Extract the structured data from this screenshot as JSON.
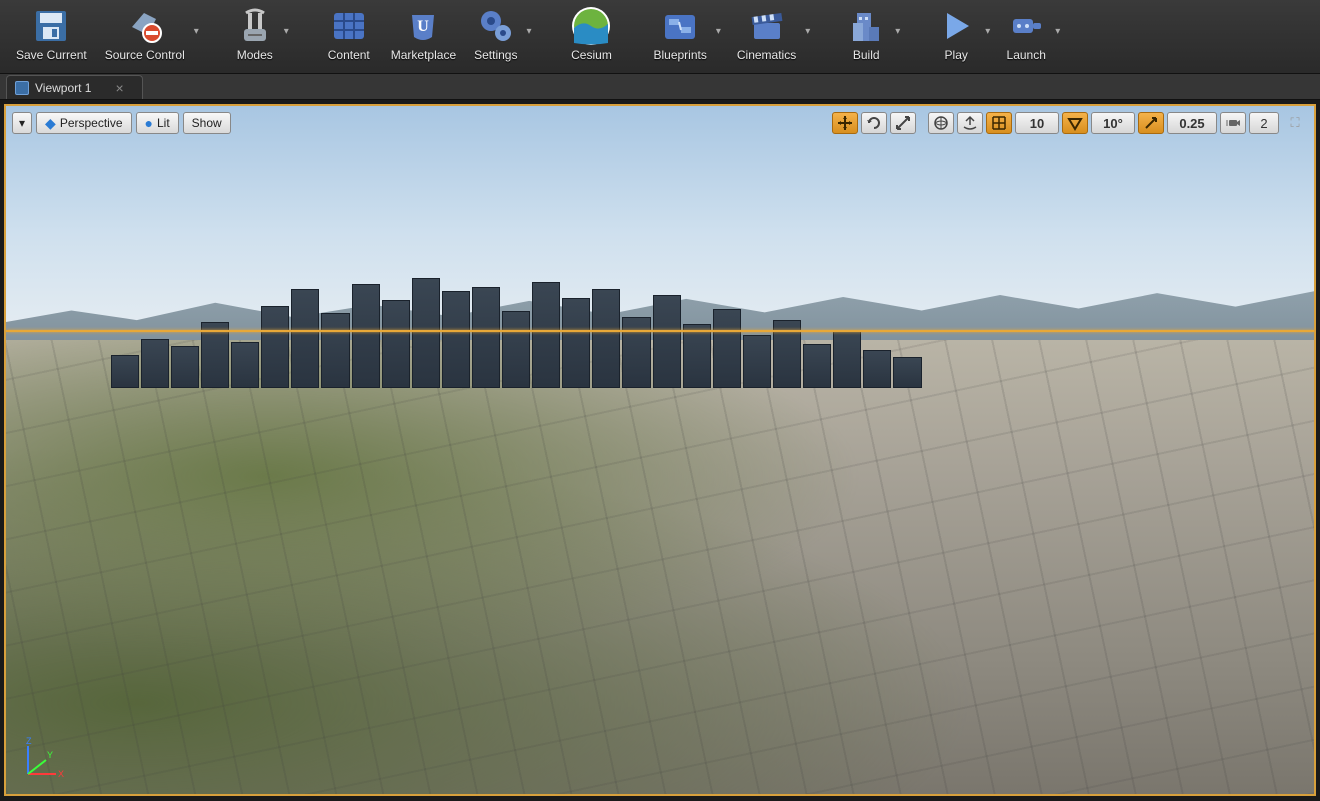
{
  "toolbar": {
    "items": [
      {
        "label": "Save Current",
        "icon": "save-icon",
        "dropdown": false
      },
      {
        "label": "Source Control",
        "icon": "source-control-icon",
        "dropdown": true
      },
      {
        "label": "Modes",
        "icon": "modes-icon",
        "dropdown": true
      },
      {
        "label": "Content",
        "icon": "content-icon",
        "dropdown": false
      },
      {
        "label": "Marketplace",
        "icon": "marketplace-icon",
        "dropdown": false
      },
      {
        "label": "Settings",
        "icon": "settings-icon",
        "dropdown": true
      },
      {
        "label": "Cesium",
        "icon": "cesium-icon",
        "dropdown": false
      },
      {
        "label": "Blueprints",
        "icon": "blueprints-icon",
        "dropdown": true
      },
      {
        "label": "Cinematics",
        "icon": "cinematics-icon",
        "dropdown": true
      },
      {
        "label": "Build",
        "icon": "build-icon",
        "dropdown": true
      },
      {
        "label": "Play",
        "icon": "play-icon",
        "dropdown": true
      },
      {
        "label": "Launch",
        "icon": "launch-icon",
        "dropdown": true
      }
    ]
  },
  "tabs": {
    "active": "Viewport 1"
  },
  "viewport": {
    "left": {
      "options_dropdown": "▾",
      "perspective": "Perspective",
      "lit": "Lit",
      "show": "Show"
    },
    "right": {
      "grid_snap": "10",
      "rotation_snap": "10°",
      "scale_snap": "0.25",
      "camera_speed": "2"
    }
  },
  "colors": {
    "accent_orange": "#d8a03c",
    "toolbar_bg": "#2f2f2f"
  }
}
